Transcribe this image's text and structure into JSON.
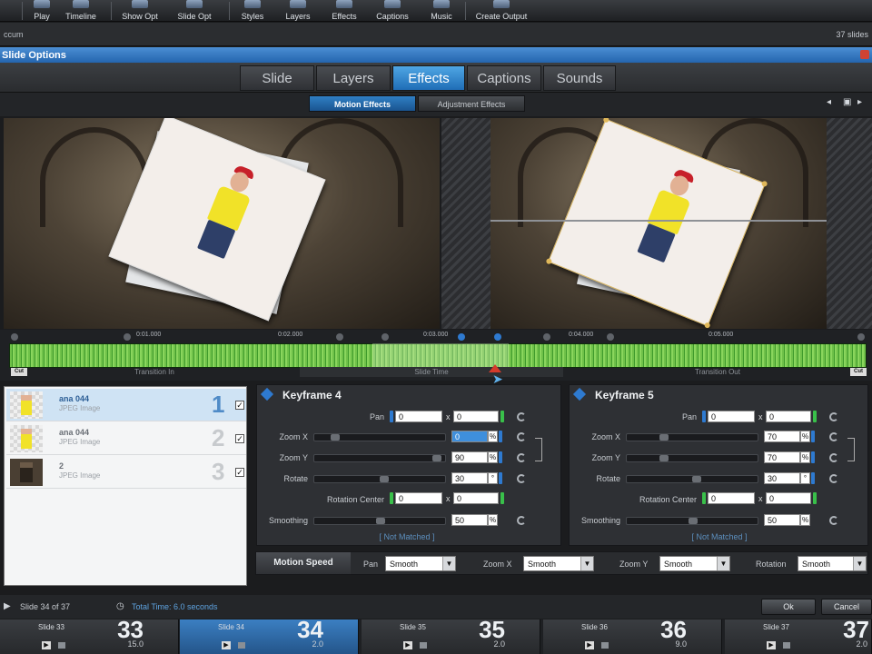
{
  "toolbar": {
    "items": [
      "Play",
      "Timeline",
      "Show Opt",
      "Slide Opt",
      "Styles",
      "Layers",
      "Effects",
      "Captions",
      "Music",
      "Create Output"
    ]
  },
  "project": {
    "name": "ccum",
    "slide_count": "37 slides"
  },
  "dialog": {
    "title": "Slide Options"
  },
  "tabs": {
    "items": [
      "Slide",
      "Layers",
      "Effects",
      "Captions",
      "Sounds"
    ],
    "active": "Effects"
  },
  "subtabs": {
    "items": [
      "Motion Effects",
      "Adjustment Effects"
    ],
    "active": "Motion Effects"
  },
  "timeline": {
    "timecodes": [
      "0:01.000",
      "0:02.000",
      "0:03.000",
      "0:04.000",
      "0:05.000"
    ],
    "zones": [
      "Transition In",
      "Slide Time",
      "Transition Out"
    ],
    "cut_label": "Cut"
  },
  "layers": [
    {
      "name": "ana 044",
      "type": "JPEG Image",
      "number": "1",
      "checked": "✓"
    },
    {
      "name": "ana 044",
      "type": "JPEG Image",
      "number": "2",
      "checked": "✓"
    },
    {
      "name": "2",
      "type": "JPEG Image",
      "number": "3",
      "checked": "✓"
    }
  ],
  "kf_left": {
    "title": "Keyframe 4",
    "pan_label": "Pan",
    "pan_x": "0",
    "pan_y": "0",
    "zoomx_label": "Zoom X",
    "zoomx": "0",
    "zoomy_label": "Zoom Y",
    "zoomy": "90",
    "rotate_label": "Rotate",
    "rotate": "30",
    "rc_label": "Rotation Center",
    "rc_x": "0",
    "rc_y": "0",
    "smoothing_label": "Smoothing",
    "smoothing": "50",
    "not_matched": "[ Not Matched ]",
    "pct": "%",
    "deg": "°",
    "x": "x"
  },
  "kf_right": {
    "title": "Keyframe 5",
    "pan_label": "Pan",
    "pan_x": "0",
    "pan_y": "0",
    "zoomx_label": "Zoom X",
    "zoomx": "70",
    "zoomy_label": "Zoom Y",
    "zoomy": "70",
    "rotate_label": "Rotate",
    "rotate": "30",
    "rc_label": "Rotation Center",
    "rc_x": "0",
    "rc_y": "0",
    "smoothing_label": "Smoothing",
    "smoothing": "50",
    "not_matched": "[ Not Matched ]",
    "pct": "%",
    "deg": "°",
    "x": "x"
  },
  "motion": {
    "title": "Motion Speed",
    "pan_label": "Pan",
    "pan": "Smooth",
    "zoomx_label": "Zoom X",
    "zoomx": "Smooth",
    "zoomy_label": "Zoom Y",
    "zoomy": "Smooth",
    "rotation_label": "Rotation",
    "rotation": "Smooth"
  },
  "status": {
    "slide": "Slide 34 of 37",
    "total_time": "Total Time: 6.0 seconds",
    "ok": "Ok",
    "cancel": "Cancel"
  },
  "filmstrip": [
    {
      "label": "Slide 33",
      "num": "33",
      "time": "15.0"
    },
    {
      "label": "Slide 34",
      "num": "34",
      "time": "2.0"
    },
    {
      "label": "Slide 35",
      "num": "35",
      "time": "2.0"
    },
    {
      "label": "Slide 36",
      "num": "36",
      "time": "9.0"
    },
    {
      "label": "Slide 37",
      "num": "37",
      "time": "2.0"
    }
  ],
  "colors": {
    "accent": "#2e7ad0",
    "waveform": "#6fc149",
    "title_bar": "#2465ae"
  }
}
